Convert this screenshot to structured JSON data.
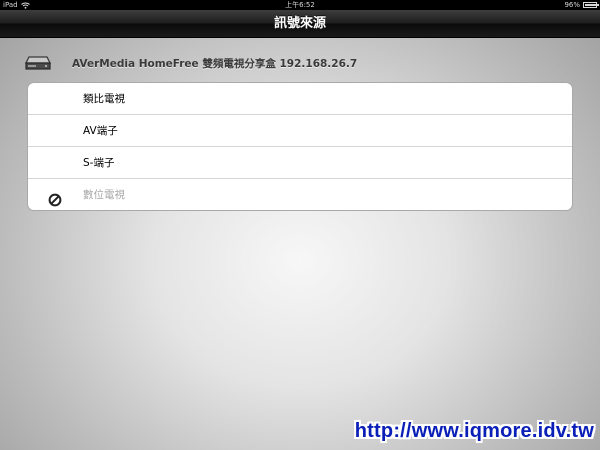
{
  "status_bar": {
    "device": "iPad",
    "time": "上午6:52",
    "battery": "96%",
    "battery_level": 0.96
  },
  "nav": {
    "title": "訊號來源"
  },
  "device_header": {
    "icon": "set-top-box-icon",
    "label": "AVerMedia HomeFree 雙頻電視分享盒 192.168.26.7"
  },
  "sources": [
    {
      "label": "類比電視",
      "enabled": true
    },
    {
      "label": "AV端子",
      "enabled": true
    },
    {
      "label": "S-端子",
      "enabled": true
    },
    {
      "label": "數位電視",
      "enabled": false,
      "icon": "no-entry-icon"
    }
  ],
  "watermark": "http://www.iqmore.idv.tw",
  "colors": {
    "nav_bar": "#1d1d1d",
    "watermark": "#0a1fb8",
    "disabled_text": "#a8a8a8"
  }
}
